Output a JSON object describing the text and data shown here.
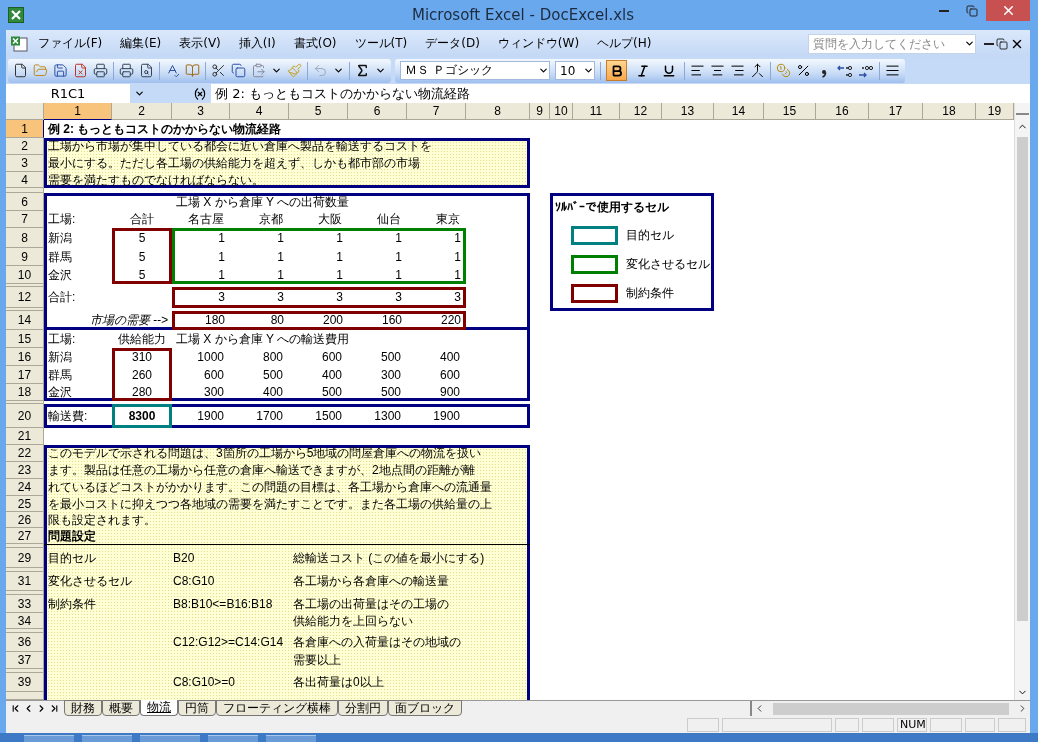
{
  "window": {
    "title": "Microsoft Excel - DocExcel.xls"
  },
  "menu": [
    "ファイル(F)",
    "編集(E)",
    "表示(V)",
    "挿入(I)",
    "書式(O)",
    "ツール(T)",
    "データ(D)",
    "ウィンドウ(W)",
    "ヘルプ(H)"
  ],
  "help_search": {
    "placeholder": "質問を入力してください"
  },
  "formatting": {
    "font": "ＭＳ Ｐゴシック",
    "size": "10",
    "bold": true,
    "italic": false,
    "underline": false
  },
  "formula_bar": {
    "name_box": "R1C1",
    "formula": "例 2:  もっともコストのかからない物流経路"
  },
  "column_headers": [
    {
      "label": "1",
      "selected": true
    },
    {
      "label": "2",
      "selected": false
    },
    {
      "label": "3",
      "selected": false
    },
    {
      "label": "4",
      "selected": false
    },
    {
      "label": "5",
      "selected": false
    },
    {
      "label": "6",
      "selected": false
    },
    {
      "label": "7",
      "selected": false
    },
    {
      "label": "8",
      "selected": false
    },
    {
      "label": "9",
      "selected": false
    },
    {
      "label": "10",
      "selected": false
    },
    {
      "label": "11",
      "selected": false
    },
    {
      "label": "12",
      "selected": false
    },
    {
      "label": "13",
      "selected": false
    },
    {
      "label": "14",
      "selected": false
    },
    {
      "label": "15",
      "selected": false
    },
    {
      "label": "16",
      "selected": false
    },
    {
      "label": "17",
      "selected": false
    },
    {
      "label": "18",
      "selected": false
    },
    {
      "label": "19",
      "selected": false
    }
  ],
  "row_headers": [
    {
      "label": "1",
      "selected": true
    },
    {
      "label": "2",
      "selected": false
    },
    {
      "label": "3",
      "selected": false
    },
    {
      "label": "4",
      "selected": false
    },
    {
      "selected": false
    },
    {
      "label": "6",
      "selected": false
    },
    {
      "label": "7",
      "selected": false
    },
    {
      "label": "8",
      "selected": false
    },
    {
      "label": "9",
      "selected": false
    },
    {
      "label": "10",
      "selected": false
    },
    {
      "selected": false
    },
    {
      "label": "12",
      "selected": false
    },
    {
      "selected": false
    },
    {
      "label": "14",
      "selected": false
    },
    {
      "label": "15",
      "selected": false
    },
    {
      "label": "16",
      "selected": false
    },
    {
      "label": "17",
      "selected": false
    },
    {
      "label": "18",
      "selected": false
    },
    {
      "selected": false
    },
    {
      "label": "20",
      "selected": false
    },
    {
      "label": "21",
      "selected": false
    },
    {
      "label": "22",
      "selected": false
    },
    {
      "label": "23",
      "selected": false
    },
    {
      "label": "24",
      "selected": false
    },
    {
      "label": "25",
      "selected": false
    },
    {
      "label": "26",
      "selected": false
    },
    {
      "label": "27",
      "selected": false
    },
    {
      "selected": false
    },
    {
      "label": "29",
      "selected": false
    },
    {
      "selected": false
    },
    {
      "label": "31",
      "selected": false
    },
    {
      "selected": false
    },
    {
      "label": "33",
      "selected": false
    },
    {
      "label": "34",
      "selected": false
    },
    {
      "selected": false
    },
    {
      "label": "36",
      "selected": false
    },
    {
      "label": "37",
      "selected": false
    },
    {
      "selected": false
    },
    {
      "label": "39",
      "selected": false
    },
    {
      "selected": false
    }
  ],
  "sheet": {
    "title": "例 2:  もっともコストのかからない物流経路",
    "intro": [
      "工場から市場が集中している都会に近い倉庫へ製品を輸送するコストを",
      "最小にする。ただし各工場の供給能力を超えず、しかも都市部の市場",
      "需要を満たすものでなければならない。"
    ],
    "shipments": {
      "title": "工場 X から倉庫 Y への出荷数量",
      "corner": "工場:",
      "total_label": "合計",
      "warehouses": [
        "名古屋",
        "京都",
        "大阪",
        "仙台",
        "東京"
      ],
      "plants": [
        {
          "name": "新潟",
          "total": "5",
          "values": [
            "1",
            "1",
            "1",
            "1",
            "1"
          ]
        },
        {
          "name": "群馬",
          "total": "5",
          "values": [
            "1",
            "1",
            "1",
            "1",
            "1"
          ]
        },
        {
          "name": "金沢",
          "total": "5",
          "values": [
            "1",
            "1",
            "1",
            "1",
            "1"
          ]
        }
      ],
      "totals": {
        "label": "合計:",
        "values": [
          "3",
          "3",
          "3",
          "3",
          "3"
        ]
      },
      "demand": {
        "label": "市場の需要 -->",
        "values": [
          "180",
          "80",
          "200",
          "160",
          "220"
        ]
      }
    },
    "costs": {
      "corner": "工場:",
      "capacity_label": "供給能力",
      "title": "工場 X から倉庫 Y への輸送費用",
      "plants": [
        {
          "name": "新潟",
          "capacity": "310",
          "values": [
            "1000",
            "800",
            "600",
            "500",
            "400"
          ]
        },
        {
          "name": "群馬",
          "capacity": "260",
          "values": [
            "600",
            "500",
            "400",
            "300",
            "600"
          ]
        },
        {
          "name": "金沢",
          "capacity": "280",
          "values": [
            "300",
            "400",
            "500",
            "500",
            "900"
          ]
        }
      ]
    },
    "transport": {
      "label": "輸送費:",
      "total": "8300",
      "values": [
        "1900",
        "1700",
        "1500",
        "1300",
        "1900"
      ]
    },
    "model_text": [
      "このモデルで示される問題は、3箇所の工場から5地域の問屋倉庫への物流を扱い",
      "ます。製品は任意の工場から任意の倉庫へ輸送できますが、2地点間の距離が離",
      "れているほどコストがかかります。この問題の目標は、各工場から倉庫への流通量",
      "を最小コストに抑えつつ各地域の需要を満たすことです。また各工場の供給量の上",
      "限も設定されます。"
    ],
    "setup": {
      "title": "問題設定",
      "items": [
        {
          "name": "目的セル",
          "range": "B20",
          "note": [
            "総輸送コスト (この値を最小にする)"
          ]
        },
        {
          "name": "変化させるセル",
          "range": "C8:G10",
          "note": [
            "各工場から各倉庫への輸送量"
          ]
        },
        {
          "name": "制約条件",
          "range": "B8:B10<=B16:B18",
          "note": [
            "各工場の出荷量はその工場の",
            "供給能力を上回らない"
          ]
        },
        {
          "range": "C12:G12>=C14:G14",
          "note": [
            "各倉庫への入荷量はその地域の",
            "需要以上"
          ]
        },
        {
          "range": "C8:G10>=0",
          "note": [
            "各出荷量は0以上"
          ]
        }
      ]
    },
    "legend": {
      "title": "ｿﾙﾊﾞｰで使用するセル",
      "items": [
        {
          "label": "目的セル",
          "color": "#008080"
        },
        {
          "label": "変化させるセル",
          "color": "#008000"
        },
        {
          "label": "制約条件",
          "color": "#800000"
        }
      ]
    }
  },
  "sheet_tabs": [
    {
      "label": "財務",
      "selected": false
    },
    {
      "label": "概要",
      "selected": false
    },
    {
      "label": "物流",
      "selected": true
    },
    {
      "label": "円筒",
      "selected": false
    },
    {
      "label": "フローティング横棒",
      "selected": false
    },
    {
      "label": "分割円",
      "selected": false
    },
    {
      "label": "面ブロック",
      "selected": false
    }
  ],
  "status_bar": {
    "indicator": "NUM"
  }
}
